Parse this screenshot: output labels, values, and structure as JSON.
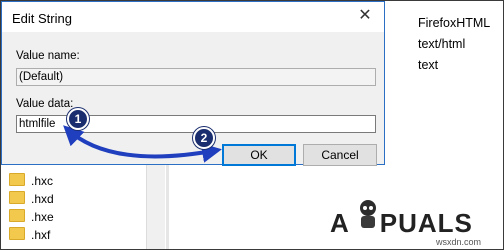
{
  "dialog": {
    "title": "Edit String",
    "close_glyph": "✕",
    "value_name_label": "Value name:",
    "value_name": "(Default)",
    "value_data_label": "Value data:",
    "value_data": "htmlfile",
    "ok_label": "OK",
    "cancel_label": "Cancel"
  },
  "registry_tree": [
    ".hxc",
    ".hxd",
    ".hxe",
    ".hxf"
  ],
  "right_pane": [
    "FirefoxHTML",
    "text/html",
    "text"
  ],
  "annotations": {
    "step1": "1",
    "step2": "2",
    "arrow_color": "#1f3fbf"
  },
  "watermark": {
    "logo_left": "A",
    "logo_right": "PUALS",
    "site": "wsxdn.com"
  }
}
